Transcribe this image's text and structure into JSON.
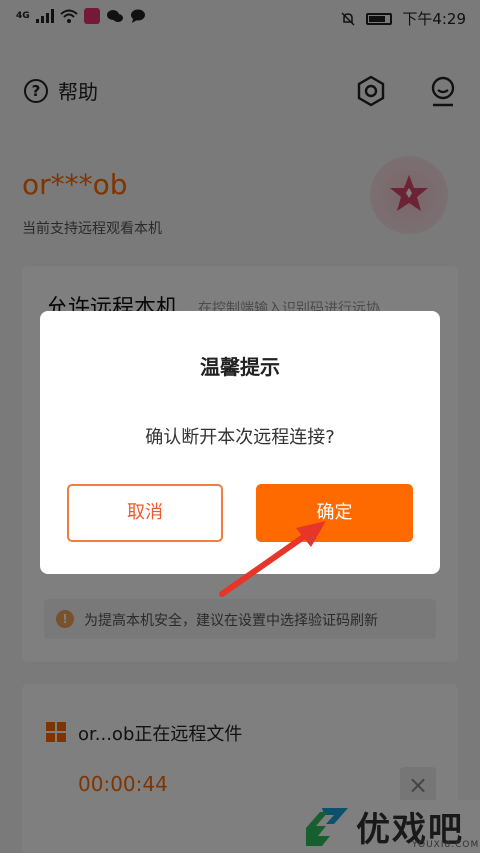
{
  "status_bar": {
    "network": "4G",
    "time": "下午4:29"
  },
  "header": {
    "help_label": "帮助",
    "settings_icon": "hexagon-settings-icon",
    "profile_icon": "user-profile-icon"
  },
  "account": {
    "name": "or***ob",
    "subtitle": "当前支持远程观看本机"
  },
  "allow_card": {
    "title": "允许远程本机",
    "hint": "在控制端输入识别码进行远协",
    "tip": "为提高本机安全，建议在设置中选择验证码刷新"
  },
  "session": {
    "text": "or...ob正在远程文件",
    "timer": "00:00:44",
    "close_label": "×"
  },
  "dialog": {
    "title": "温馨提示",
    "message": "确认断开本次远程连接?",
    "cancel_label": "取消",
    "confirm_label": "确定"
  },
  "watermark": {
    "brand": "优戏吧",
    "domain": "YOUXI8.COM"
  },
  "colors": {
    "accent": "#ff6a00",
    "cancel_border": "#f47c3c",
    "arrow": "#e8352a"
  }
}
